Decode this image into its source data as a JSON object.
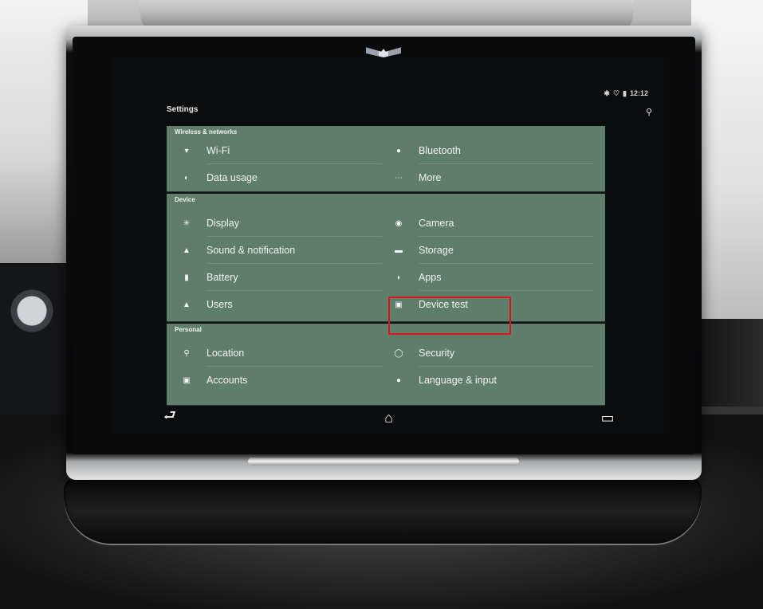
{
  "status_bar": {
    "bluetooth_icon": "bluetooth-icon",
    "wifi_icon": "wifi-icon",
    "battery_icon": "battery-icon",
    "time": "12:12"
  },
  "header": {
    "title": "Settings",
    "search_icon": "search-icon"
  },
  "sections": [
    {
      "title": "Wireless & networks",
      "items": [
        {
          "label": "Wi-Fi",
          "icon": "wifi-icon"
        },
        {
          "label": "Bluetooth",
          "icon": "bluetooth-icon"
        },
        {
          "label": "Data usage",
          "icon": "data-usage-icon"
        },
        {
          "label": "More",
          "icon": "more-icon"
        }
      ]
    },
    {
      "title": "Device",
      "items": [
        {
          "label": "Display",
          "icon": "display-brightness-icon"
        },
        {
          "label": "Camera",
          "icon": "camera-icon"
        },
        {
          "label": "Sound & notification",
          "icon": "bell-icon"
        },
        {
          "label": "Storage",
          "icon": "storage-icon"
        },
        {
          "label": "Battery",
          "icon": "battery-icon"
        },
        {
          "label": "Apps",
          "icon": "android-icon"
        },
        {
          "label": "Users",
          "icon": "users-icon"
        },
        {
          "label": "Device test",
          "icon": "device-test-icon"
        }
      ]
    },
    {
      "title": "Personal",
      "items": [
        {
          "label": "Location",
          "icon": "location-pin-icon"
        },
        {
          "label": "Security",
          "icon": "lock-icon"
        },
        {
          "label": "Accounts",
          "icon": "account-icon"
        },
        {
          "label": "Language & input",
          "icon": "globe-icon"
        }
      ]
    }
  ],
  "nav_bar": {
    "back_icon": "back-icon",
    "home_icon": "home-icon",
    "recents_icon": "recents-icon"
  },
  "colors": {
    "section_bg": "#5e7d6a",
    "highlight": "#e0141a",
    "screen_bg": "#0b0c0e"
  }
}
